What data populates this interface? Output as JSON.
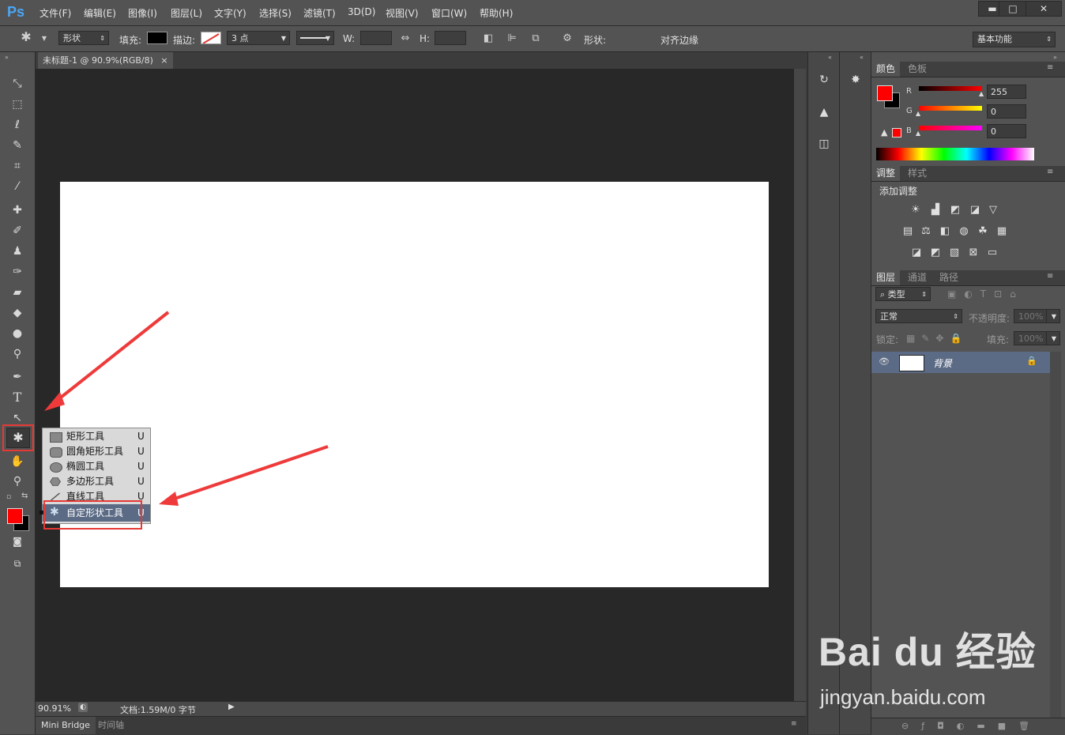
{
  "app": {
    "logo": "Ps"
  },
  "menubar": {
    "items": [
      "文件(F)",
      "编辑(E)",
      "图像(I)",
      "图层(L)",
      "文字(Y)",
      "选择(S)",
      "滤镜(T)",
      "3D(D)",
      "视图(V)",
      "窗口(W)",
      "帮助(H)"
    ],
    "window_buttons": [
      "▬",
      "□",
      "✕"
    ]
  },
  "options": {
    "mode": "形状",
    "fill_label": "填充:",
    "stroke_label": "描边:",
    "stroke_width": "3 点",
    "w_label": "W:",
    "h_label": "H:",
    "shape_label": "形状:",
    "align_edges": "对齐边缘",
    "workspace": "基本功能",
    "colors": {
      "fill": "#000000",
      "stroke": "#ffffff"
    }
  },
  "document": {
    "tab_title": "未标题-1 @ 90.9%(RGB/8)",
    "tab_close": "×",
    "zoom": "90.91%",
    "doc_info": "文档:1.59M/0 字节"
  },
  "bottom_tabs": [
    "Mini Bridge",
    "时间轴"
  ],
  "flyout": {
    "items": [
      {
        "label": "矩形工具",
        "key": "U",
        "icon": "rectangle-icon"
      },
      {
        "label": "圆角矩形工具",
        "key": "U",
        "icon": "rounded-rectangle-icon"
      },
      {
        "label": "椭圆工具",
        "key": "U",
        "icon": "ellipse-icon"
      },
      {
        "label": "多边形工具",
        "key": "U",
        "icon": "polygon-icon"
      },
      {
        "label": "直线工具",
        "key": "U",
        "icon": "line-icon"
      },
      {
        "label": "自定形状工具",
        "key": "U",
        "icon": "custom-shape-icon"
      }
    ]
  },
  "color_panel": {
    "tabs": [
      "颜色",
      "色板"
    ],
    "channels": [
      {
        "label": "R",
        "value": "255"
      },
      {
        "label": "G",
        "value": "0"
      },
      {
        "label": "B",
        "value": "0"
      }
    ],
    "foreground": "#ff0000",
    "background": "#000000"
  },
  "adjust_panel": {
    "tabs": [
      "调整",
      "样式"
    ],
    "add_label": "添加调整"
  },
  "layers_panel": {
    "tabs": [
      "图层",
      "通道",
      "路径"
    ],
    "filter_label": "类型",
    "blend_mode": "正常",
    "opacity_label": "不透明度:",
    "opacity_value": "100%",
    "lock_label": "锁定:",
    "fill_label": "填充:",
    "fill_value": "100%",
    "layer_name": "背景"
  },
  "watermark": {
    "brand": "Bai du 经验",
    "url": "jingyan.baidu.com"
  }
}
